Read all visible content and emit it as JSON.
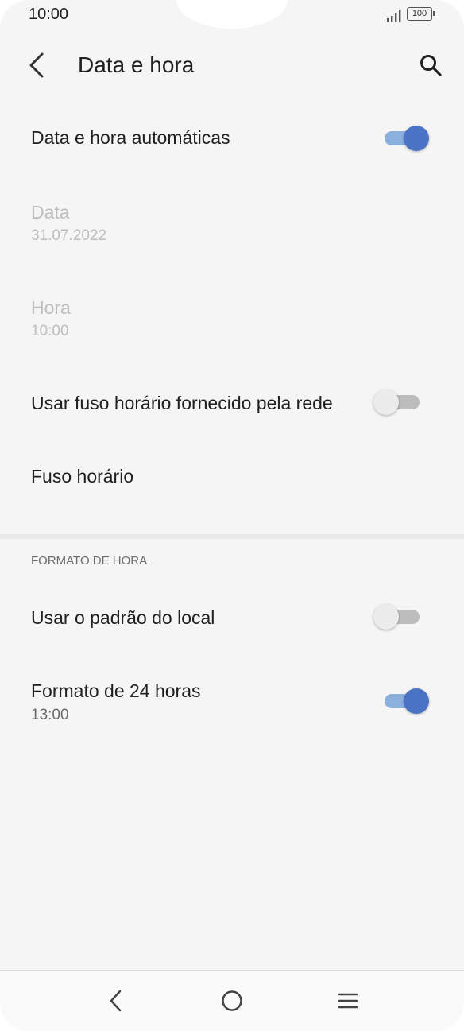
{
  "status_bar": {
    "time": "10:00",
    "battery": "100"
  },
  "app_bar": {
    "title": "Data e hora"
  },
  "settings": {
    "auto_datetime": {
      "title": "Data e hora automáticas",
      "enabled": true
    },
    "date": {
      "title": "Data",
      "value": "31.07.2022"
    },
    "time": {
      "title": "Hora",
      "value": "10:00"
    },
    "network_timezone": {
      "title": "Usar fuso horário fornecido pela rede",
      "enabled": false
    },
    "timezone": {
      "title": "Fuso horário"
    }
  },
  "time_format": {
    "header": "FORMATO DE HORA",
    "locale_default": {
      "title": "Usar o padrão do local",
      "enabled": false
    },
    "format_24h": {
      "title": "Formato de 24 horas",
      "example": "13:00",
      "enabled": true
    }
  },
  "colors": {
    "switch_on_thumb": "#4a73c6",
    "switch_on_track": "#8ab0dd",
    "switch_off_thumb": "#ececec",
    "switch_off_track": "#bdbdbd",
    "background": "#f5f5f5"
  }
}
